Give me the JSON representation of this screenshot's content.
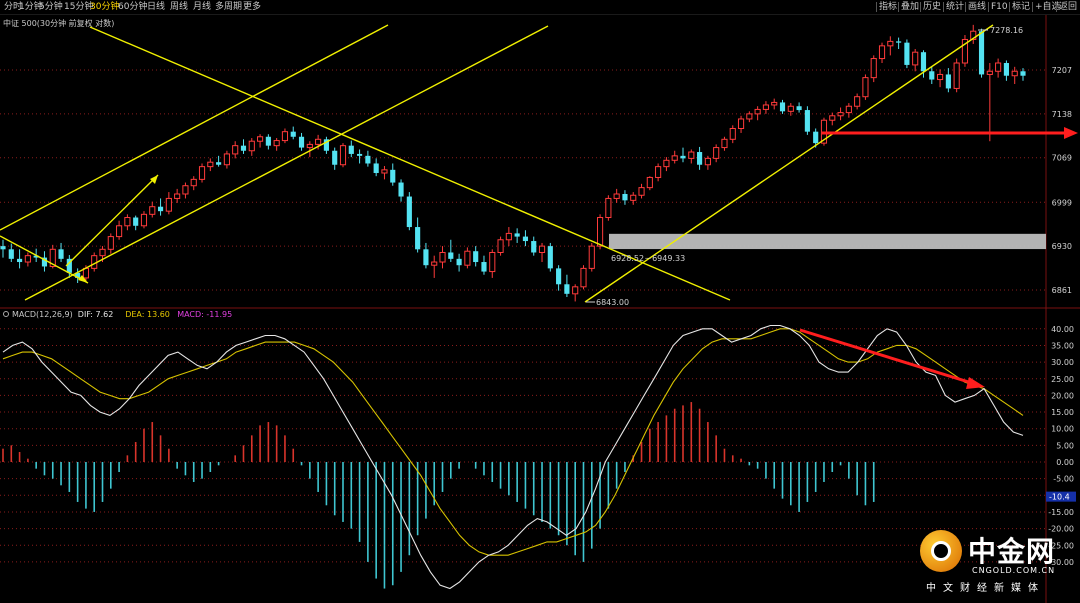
{
  "toolbar": {
    "periods": [
      "分时",
      "1分钟",
      "5分钟",
      "15分钟",
      "30分钟",
      "60分钟",
      "日线",
      "周线",
      "月线",
      "多周期",
      "更多"
    ],
    "active_period": "30分钟",
    "tools": [
      "指标",
      "叠加",
      "历史",
      "统计",
      "画线",
      "F10",
      "标记",
      "+自选",
      "返回"
    ]
  },
  "legends": {
    "main": "中证 500(30分钟 前复权 对数)",
    "macd_name": "MACD(12,26,9)",
    "dif": "DIF: 7.62",
    "dea": "DEA: 13.60",
    "macd": "MACD: -11.95"
  },
  "annotations": {
    "high": "7278.16",
    "low": "6843.00",
    "gap": "6928.52－6949.33",
    "macd_marker": "-10.4"
  },
  "logo": {
    "cn": "中金网",
    "url": "CNGOLD.COM.CN",
    "slogan": "中文财经新媒体"
  },
  "colors": {
    "up": "#ff3b3b",
    "down": "#54e3f2",
    "trendline": "#f0f000",
    "dif_line": "#e6e6e6",
    "dea_line": "#d6c200",
    "arrow": "#ff1e1e",
    "gap_box": "#bdbdbd",
    "grid": "#8a1c1c"
  },
  "chart_data": [
    {
      "type": "candlestick",
      "title": "中证 500(30分钟 前复权 对数)",
      "y_ticks": [
        7207,
        7138,
        7069,
        6999,
        6930,
        6861
      ],
      "ylim": [
        6830,
        7300
      ],
      "candles": [
        [
          6930,
          6940,
          6912,
          6925
        ],
        [
          6925,
          6934,
          6905,
          6910
        ],
        [
          6910,
          6925,
          6895,
          6905
        ],
        [
          6905,
          6920,
          6898,
          6915
        ],
        [
          6915,
          6926,
          6905,
          6912
        ],
        [
          6912,
          6922,
          6890,
          6898
        ],
        [
          6898,
          6932,
          6895,
          6925
        ],
        [
          6925,
          6935,
          6905,
          6910
        ],
        [
          6910,
          6916,
          6880,
          6888
        ],
        [
          6888,
          6895,
          6872,
          6880
        ],
        [
          6880,
          6900,
          6875,
          6895
        ],
        [
          6895,
          6920,
          6890,
          6915
        ],
        [
          6915,
          6930,
          6905,
          6925
        ],
        [
          6925,
          6950,
          6918,
          6945
        ],
        [
          6945,
          6970,
          6940,
          6962
        ],
        [
          6962,
          6980,
          6955,
          6975
        ],
        [
          6975,
          6978,
          6955,
          6962
        ],
        [
          6962,
          6985,
          6958,
          6980
        ],
        [
          6980,
          7000,
          6975,
          6992
        ],
        [
          6992,
          7005,
          6978,
          6985
        ],
        [
          6985,
          7015,
          6980,
          7005
        ],
        [
          7005,
          7020,
          6998,
          7012
        ],
        [
          7012,
          7030,
          7005,
          7025
        ],
        [
          7025,
          7040,
          7018,
          7035
        ],
        [
          7035,
          7060,
          7030,
          7055
        ],
        [
          7055,
          7068,
          7048,
          7062
        ],
        [
          7062,
          7072,
          7055,
          7058
        ],
        [
          7058,
          7080,
          7052,
          7075
        ],
        [
          7075,
          7095,
          7068,
          7088
        ],
        [
          7088,
          7098,
          7075,
          7080
        ],
        [
          7080,
          7100,
          7072,
          7095
        ],
        [
          7095,
          7106,
          7085,
          7102
        ],
        [
          7102,
          7106,
          7082,
          7088
        ],
        [
          7088,
          7100,
          7080,
          7096
        ],
        [
          7096,
          7115,
          7092,
          7110
        ],
        [
          7110,
          7118,
          7098,
          7102
        ],
        [
          7102,
          7108,
          7080,
          7085
        ],
        [
          7085,
          7095,
          7070,
          7090
        ],
        [
          7090,
          7105,
          7082,
          7098
        ],
        [
          7098,
          7102,
          7075,
          7080
        ],
        [
          7080,
          7085,
          7050,
          7058
        ],
        [
          7058,
          7092,
          7054,
          7088
        ],
        [
          7088,
          7096,
          7070,
          7075
        ],
        [
          7075,
          7082,
          7060,
          7072
        ],
        [
          7072,
          7080,
          7055,
          7060
        ],
        [
          7060,
          7068,
          7040,
          7045
        ],
        [
          7045,
          7056,
          7035,
          7050
        ],
        [
          7050,
          7060,
          7025,
          7030
        ],
        [
          7030,
          7035,
          7000,
          7008
        ],
        [
          7008,
          7015,
          6955,
          6960
        ],
        [
          6960,
          6975,
          6920,
          6925
        ],
        [
          6925,
          6935,
          6895,
          6900
        ],
        [
          6900,
          6915,
          6880,
          6905
        ],
        [
          6905,
          6930,
          6895,
          6920
        ],
        [
          6920,
          6940,
          6905,
          6910
        ],
        [
          6910,
          6918,
          6890,
          6900
        ],
        [
          6900,
          6928,
          6895,
          6922
        ],
        [
          6922,
          6930,
          6898,
          6905
        ],
        [
          6905,
          6915,
          6885,
          6890
        ],
        [
          6890,
          6925,
          6880,
          6920
        ],
        [
          6920,
          6945,
          6915,
          6940
        ],
        [
          6940,
          6960,
          6930,
          6950
        ],
        [
          6950,
          6958,
          6935,
          6945
        ],
        [
          6945,
          6955,
          6930,
          6938
        ],
        [
          6938,
          6945,
          6915,
          6920
        ],
        [
          6920,
          6935,
          6905,
          6930
        ],
        [
          6930,
          6935,
          6890,
          6895
        ],
        [
          6895,
          6900,
          6860,
          6870
        ],
        [
          6870,
          6885,
          6850,
          6855
        ],
        [
          6855,
          6870,
          6843,
          6866
        ],
        [
          6866,
          6900,
          6862,
          6895
        ],
        [
          6895,
          6935,
          6890,
          6930
        ],
        [
          6930,
          6980,
          6925,
          6975
        ],
        [
          6975,
          7010,
          6970,
          7005
        ],
        [
          7005,
          7020,
          6998,
          7012
        ],
        [
          7012,
          7018,
          6995,
          7002
        ],
        [
          7002,
          7015,
          6995,
          7010
        ],
        [
          7010,
          7028,
          7005,
          7022
        ],
        [
          7022,
          7040,
          7018,
          7038
        ],
        [
          7038,
          7060,
          7032,
          7055
        ],
        [
          7055,
          7070,
          7048,
          7065
        ],
        [
          7065,
          7080,
          7060,
          7072
        ],
        [
          7072,
          7085,
          7062,
          7068
        ],
        [
          7068,
          7082,
          7060,
          7078
        ],
        [
          7078,
          7086,
          7050,
          7058
        ],
        [
          7058,
          7072,
          7050,
          7068
        ],
        [
          7068,
          7090,
          7062,
          7085
        ],
        [
          7085,
          7102,
          7080,
          7098
        ],
        [
          7098,
          7120,
          7092,
          7115
        ],
        [
          7115,
          7135,
          7108,
          7130
        ],
        [
          7130,
          7142,
          7125,
          7138
        ],
        [
          7138,
          7150,
          7128,
          7145
        ],
        [
          7145,
          7158,
          7138,
          7152
        ],
        [
          7152,
          7162,
          7145,
          7156
        ],
        [
          7156,
          7160,
          7138,
          7142
        ],
        [
          7142,
          7155,
          7135,
          7150
        ],
        [
          7150,
          7156,
          7140,
          7144
        ],
        [
          7144,
          7150,
          7105,
          7110
        ],
        [
          7110,
          7115,
          7085,
          7092
        ],
        [
          7092,
          7132,
          7088,
          7128
        ],
        [
          7128,
          7140,
          7120,
          7135
        ],
        [
          7135,
          7148,
          7128,
          7140
        ],
        [
          7140,
          7155,
          7132,
          7150
        ],
        [
          7150,
          7170,
          7145,
          7165
        ],
        [
          7165,
          7200,
          7160,
          7195
        ],
        [
          7195,
          7230,
          7188,
          7225
        ],
        [
          7225,
          7250,
          7218,
          7245
        ],
        [
          7245,
          7260,
          7230,
          7252
        ],
        [
          7252,
          7258,
          7240,
          7250
        ],
        [
          7250,
          7255,
          7210,
          7215
        ],
        [
          7215,
          7240,
          7205,
          7235
        ],
        [
          7235,
          7238,
          7195,
          7205
        ],
        [
          7205,
          7212,
          7185,
          7192
        ],
        [
          7192,
          7208,
          7180,
          7200
        ],
        [
          7200,
          7210,
          7172,
          7178
        ],
        [
          7178,
          7225,
          7172,
          7218
        ],
        [
          7218,
          7262,
          7212,
          7255
        ],
        [
          7255,
          7278,
          7248,
          7268
        ],
        [
          7268,
          7272,
          7195,
          7200
        ],
        [
          7200,
          7218,
          7095,
          7205
        ],
        [
          7205,
          7225,
          7195,
          7218
        ],
        [
          7218,
          7222,
          7190,
          7198
        ],
        [
          7198,
          7212,
          7185,
          7205
        ],
        [
          7205,
          7210,
          7190,
          7198
        ]
      ]
    },
    {
      "type": "macd",
      "title": "MACD(12,26,9)",
      "y_ticks": [
        40,
        35,
        30,
        25,
        20,
        15,
        10,
        5,
        0,
        -5,
        -10,
        -15,
        -20,
        -25,
        -30
      ],
      "ylim": [
        -38,
        44
      ],
      "dif": [
        33,
        35,
        36,
        34,
        30,
        27,
        24,
        21,
        20,
        17,
        15,
        14,
        16,
        19,
        23,
        26,
        29,
        32,
        33,
        31,
        29,
        28,
        30,
        33,
        35,
        36,
        37,
        38,
        38,
        37,
        35,
        33,
        29,
        25,
        20,
        15,
        10,
        5,
        0,
        -5,
        -10,
        -16,
        -22,
        -28,
        -33,
        -37,
        -38,
        -36,
        -33,
        -30,
        -28,
        -27,
        -25,
        -22,
        -19,
        -17,
        -18,
        -20,
        -22,
        -20,
        -15,
        -8,
        0,
        5,
        10,
        15,
        20,
        25,
        30,
        35,
        38,
        39,
        40,
        40,
        38,
        36,
        37,
        38,
        40,
        41,
        41,
        40,
        38,
        35,
        30,
        28,
        27,
        27,
        30,
        34,
        38,
        40,
        39,
        35,
        30,
        27,
        26,
        20,
        18,
        19,
        20,
        22,
        17,
        12,
        9,
        8
      ],
      "dea": [
        31,
        32,
        33,
        33,
        32,
        31,
        29,
        27,
        25,
        23,
        21,
        20,
        19,
        19,
        20,
        21,
        23,
        25,
        26,
        27,
        28,
        29,
        30,
        31,
        33,
        34,
        35,
        36,
        36,
        36,
        36,
        35,
        34,
        32,
        30,
        27,
        24,
        20,
        16,
        12,
        8,
        4,
        0,
        -4,
        -9,
        -14,
        -18,
        -22,
        -25,
        -27,
        -28,
        -28,
        -28,
        -27,
        -26,
        -25,
        -24,
        -24,
        -23,
        -22,
        -21,
        -19,
        -15,
        -10,
        -4,
        2,
        8,
        14,
        19,
        24,
        28,
        31,
        34,
        36,
        37,
        37,
        37,
        37,
        38,
        39,
        40,
        40,
        39,
        37,
        35,
        33,
        31,
        30,
        30,
        31,
        33,
        34,
        35,
        35,
        34,
        32,
        30,
        28,
        26,
        24,
        23,
        22,
        20,
        18,
        16,
        14
      ],
      "macd_hist": [
        4,
        5,
        3,
        1,
        -2,
        -4,
        -5,
        -7,
        -9,
        -12,
        -14,
        -15,
        -12,
        -8,
        -3,
        2,
        6,
        10,
        12,
        8,
        4,
        -2,
        -4,
        -6,
        -5,
        -3,
        -1,
        0,
        2,
        5,
        8,
        11,
        12,
        11,
        8,
        4,
        -1,
        -5,
        -9,
        -13,
        -16,
        -18,
        -20,
        -24,
        -30,
        -35,
        -38,
        -37,
        -33,
        -28,
        -22,
        -17,
        -13,
        -9,
        -5,
        -2,
        0,
        -2,
        -4,
        -6,
        -8,
        -10,
        -12,
        -14,
        -16,
        -18,
        -20,
        -22,
        -25,
        -28,
        -30,
        -26,
        -20,
        -14,
        -8,
        -3,
        2,
        6,
        10,
        12,
        14,
        16,
        17,
        18,
        16,
        12,
        8,
        4,
        2,
        1,
        -1,
        -2,
        -5,
        -8,
        -11,
        -13,
        -15,
        -12,
        -9,
        -6,
        -3,
        -1,
        -5,
        -10,
        -13,
        -12
      ]
    }
  ]
}
